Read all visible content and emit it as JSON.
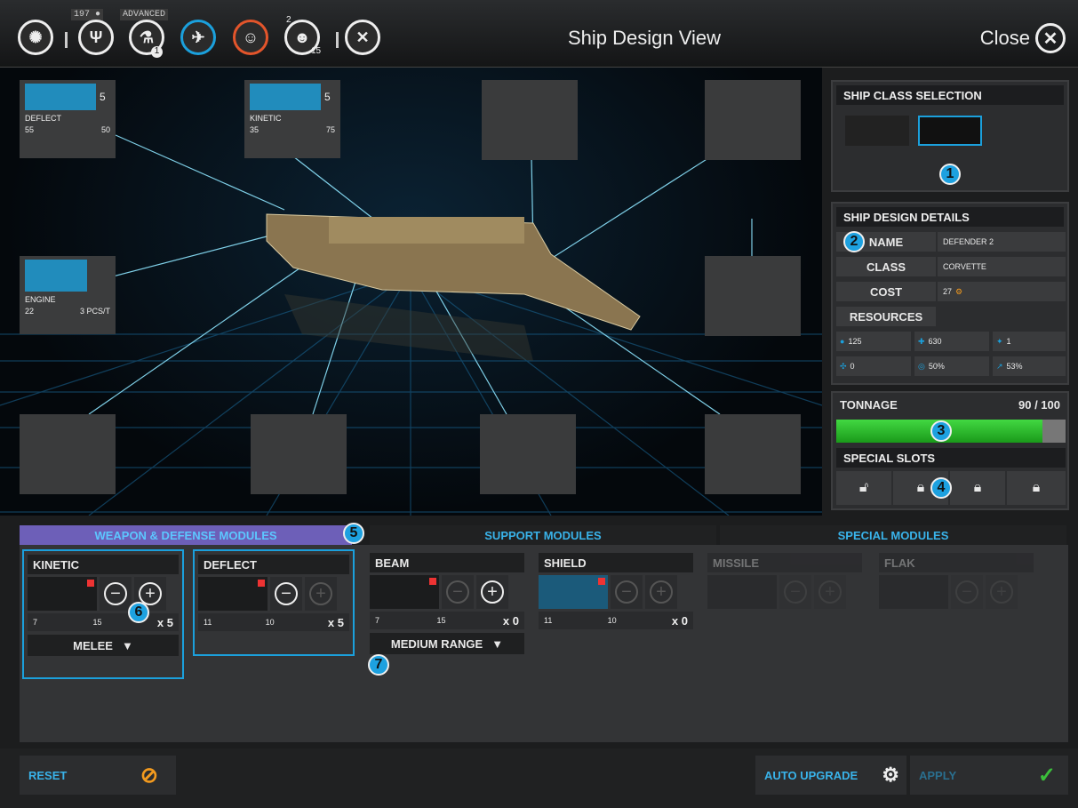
{
  "topbar": {
    "title": "Ship Design View",
    "close_label": "Close",
    "research_count": "197",
    "research_level": "ADVANCED",
    "icons": [
      "galaxy-icon",
      "council-icon",
      "research-icon",
      "military-icon",
      "diplomacy-icon",
      "population-icon",
      "settings-icon"
    ],
    "badges": {
      "council": "8",
      "research": "1",
      "population_top": "2",
      "population_bottom": "15"
    }
  },
  "viewport": {
    "slots": {
      "deflect": {
        "count": "5",
        "name": "DEFLECT",
        "stat_a": "55",
        "stat_b": "50"
      },
      "kinetic": {
        "count": "5",
        "name": "KINETIC",
        "stat_a": "35",
        "stat_b": "75"
      },
      "engine": {
        "name": "ENGINE",
        "stat_a": "22",
        "stat_b": "3 PCS/T"
      }
    }
  },
  "class_selection": {
    "header": "SHIP CLASS SELECTION",
    "marker": "1"
  },
  "design_details": {
    "header": "SHIP DESIGN DETAILS",
    "marker": "2",
    "name_label": "NAME",
    "name_value": "DEFENDER 2",
    "class_label": "CLASS",
    "class_value": "CORVETTE",
    "cost_label": "COST",
    "cost_value": "27",
    "resources_label": "RESOURCES",
    "resources": [
      "125",
      "630",
      "1",
      "0",
      "50%",
      "53%"
    ]
  },
  "tonnage": {
    "label": "TONNAGE",
    "value": "90 / 100",
    "fraction": 0.9,
    "marker": "3"
  },
  "special_slots": {
    "label": "SPECIAL SLOTS",
    "marker": "4"
  },
  "tabs": {
    "weapons": "WEAPON & DEFENSE MODULES",
    "support": "SUPPORT MODULES",
    "special": "SPECIAL MODULES",
    "marker": "5"
  },
  "modules": [
    {
      "name": "KINETIC",
      "a": "7",
      "b": "15",
      "count": "x 5",
      "range": "MELEE"
    },
    {
      "name": "DEFLECT",
      "a": "11",
      "b": "10",
      "count": "x 5"
    },
    {
      "name": "BEAM",
      "a": "7",
      "b": "15",
      "count": "x 0",
      "range": "MEDIUM RANGE"
    },
    {
      "name": "SHIELD",
      "a": "11",
      "b": "10",
      "count": "x 0"
    },
    {
      "name": "MISSILE"
    },
    {
      "name": "FLAK"
    }
  ],
  "markers": {
    "six": "6",
    "seven": "7"
  },
  "bottom": {
    "reset": "RESET",
    "auto_upgrade": "AUTO UPGRADE",
    "apply": "APPLY"
  },
  "colors": {
    "accent": "#1ba0dc",
    "tonnage_bar": "#2fc12f",
    "active_tab": "#6d5fb8",
    "cost_gear": "#f39a1e"
  }
}
